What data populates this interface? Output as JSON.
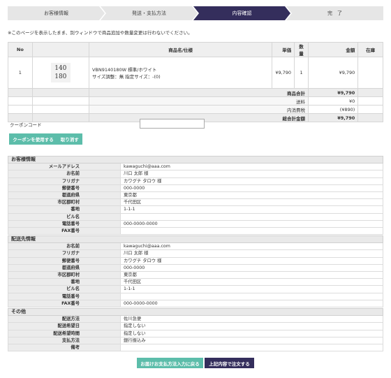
{
  "steps": [
    "お客様情報",
    "発送・支払方法",
    "内容確認",
    "完　了"
  ],
  "notice": "※このページを表示したまま、別ウィンドウで商品追加や数量変更は行わないでください。",
  "cart": {
    "headers": {
      "no": "No",
      "image": "",
      "name": "商品名/仕様",
      "price": "単価",
      "qty": "数量",
      "amount": "金額",
      "stock": "在庫"
    },
    "item": {
      "no": "1",
      "thumb_line1": "140",
      "thumb_line2": "180",
      "name_line1": "VBN9140180W 標準/ホワイト",
      "name_line2": "サイズ調整：無 指定サイズ：-(0)",
      "price": "¥9,790",
      "qty": "1",
      "amount": "¥9,790",
      "stock": ""
    },
    "summary": [
      {
        "label": "商品合計",
        "value": "¥9,790"
      },
      {
        "label": "送料",
        "value": "¥0"
      },
      {
        "label": "内消費税",
        "value": "(¥890)"
      },
      {
        "label": "総合計金額",
        "value": "¥9,790"
      }
    ]
  },
  "coupon": {
    "label": "クーポンコード",
    "input_value": "",
    "apply_label": "クーポンを使用する",
    "cancel_label": "取り消す"
  },
  "customer": {
    "title": "お客様情報",
    "rows": [
      {
        "label": "メールアドレス",
        "value": "kawaguchi@aaa.com"
      },
      {
        "label": "お名前",
        "value": "川口 太郎 様"
      },
      {
        "label": "フリガナ",
        "value": "カワグチ タロウ 様"
      },
      {
        "label": "郵便番号",
        "value": "000-0000"
      },
      {
        "label": "都道府県",
        "value": "東京都"
      },
      {
        "label": "市区郡町村",
        "value": "千代田区"
      },
      {
        "label": "番地",
        "value": "1-1-1"
      },
      {
        "label": "ビル名",
        "value": ""
      },
      {
        "label": "電話番号",
        "value": "000-0000-0000"
      },
      {
        "label": "FAX番号",
        "value": ""
      }
    ]
  },
  "shipping": {
    "title": "配送先情報",
    "rows": [
      {
        "label": "お名前",
        "value": "kawaguchi@aaa.com"
      },
      {
        "label": "フリガナ",
        "value": "川口 太郎 様"
      },
      {
        "label": "郵便番号",
        "value": "カワグチ タロウ 様"
      },
      {
        "label": "都道府県",
        "value": "000-0000"
      },
      {
        "label": "市区郡町村",
        "value": "東京都"
      },
      {
        "label": "番地",
        "value": "千代田区"
      },
      {
        "label": "ビル名",
        "value": "1-1-1"
      },
      {
        "label": "電話番号",
        "value": ""
      },
      {
        "label": "FAX番号",
        "value": "000-0000-0000"
      }
    ]
  },
  "other": {
    "title": "その他",
    "rows": [
      {
        "label": "配送方法",
        "value": "佐川急便"
      },
      {
        "label": "配送希望日",
        "value": "指定しない"
      },
      {
        "label": "配送希望時間",
        "value": "指定しない"
      },
      {
        "label": "支払方法",
        "value": "銀行振込み"
      },
      {
        "label": "備考",
        "value": ""
      }
    ]
  },
  "buttons": {
    "back": "お届けお支払方法入力に戻る",
    "order": "上記内容で注文する"
  },
  "colors": {
    "accent_dark": "#342e5c",
    "accent_teal": "#5cbdaa"
  }
}
